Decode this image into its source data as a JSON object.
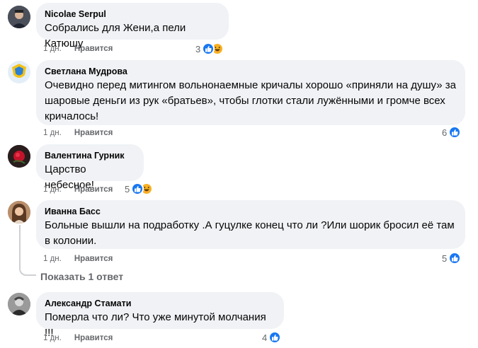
{
  "comments": [
    {
      "author": "Nicolae Serpul",
      "text": "Собрались для Жени,а пели Катюшу",
      "time": "1 дн.",
      "like_label": "Нравится",
      "reaction_count": "3",
      "reactions": [
        "like-icon",
        "haha-icon"
      ]
    },
    {
      "author": "Светлана Мудрова",
      "text": "Очевидно перед митингом вольнонаемные кричалы хорошо «приняли на душу» за шаровые деньги из рук «братьев», чтобы глотки стали лужёнными и громче всех кричалось!",
      "time": "1 дн.",
      "like_label": "Нравится",
      "reaction_count": "6",
      "reactions": [
        "like-icon"
      ]
    },
    {
      "author": "Валентина Гурник",
      "text": "Царство небесное!",
      "time": "1 дн.",
      "like_label": "Нравится",
      "reaction_count": "5",
      "reactions": [
        "like-icon",
        "haha-icon"
      ]
    },
    {
      "author": "Иванна Басс",
      "text": "Больные вышли на подработку .А гуцулке конец что ли ?Или шорик бросил её там в колонии.",
      "time": "1 дн.",
      "like_label": "Нравится",
      "reaction_count": "5",
      "reactions": [
        "like-icon"
      ]
    },
    {
      "author": "Александр Стамати",
      "text": "Померла что ли? Что уже минутой молчания !!!",
      "time": "1 дн.",
      "like_label": "Нравится",
      "reaction_count": "4",
      "reactions": [
        "like-icon"
      ]
    }
  ],
  "show_replies_label": "Показать 1 ответ",
  "colors": {
    "bubble": "#f0f2f5",
    "like_blue": "#1877f2",
    "haha_yellow": "#f7b125",
    "meta_gray": "#65676b"
  }
}
